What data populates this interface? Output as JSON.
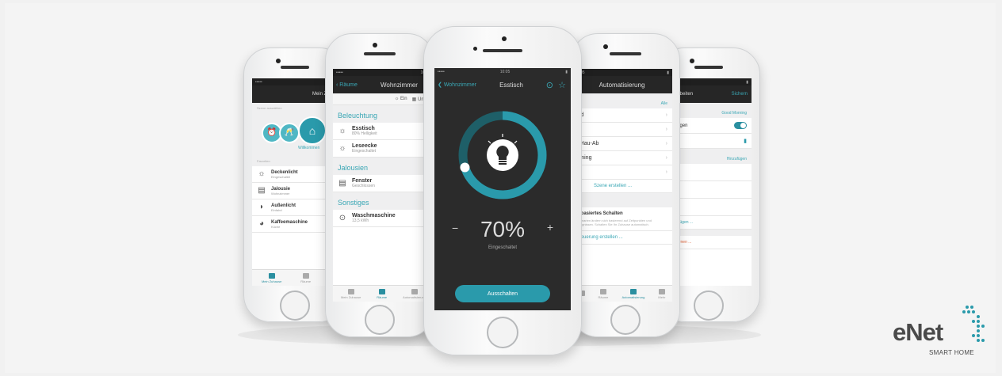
{
  "phone1": {
    "nav_title": "Mein Zuhause",
    "section_scenes": "Szene auswählen",
    "scene_label": "Willkommen",
    "section_favorites": "Favoriten",
    "favorites": [
      {
        "label": "Deckenlicht",
        "sub": "Eingeschaltet"
      },
      {
        "label": "Jalousie",
        "sub": "Wohnzimmer"
      },
      {
        "label": "Außenlicht",
        "sub": "Einfahrt"
      },
      {
        "label": "Kaffeemaschine",
        "sub": "Küche"
      }
    ],
    "tabs": [
      "Mein Zuhause",
      "Räume",
      "Au"
    ]
  },
  "phone2": {
    "back_label": "Räume",
    "nav_title": "Wohnzimmer",
    "filter_on": "Ein",
    "filter_under": "Unten",
    "section_lighting": "Beleuchtung",
    "lighting": [
      {
        "label": "Esstisch",
        "sub": "80% Helligkeit"
      },
      {
        "label": "Leseecke",
        "sub": "Eingeschaltet"
      }
    ],
    "section_blinds": "Jalousien",
    "blinds": [
      {
        "label": "Fenster",
        "sub": "Geschlossen"
      }
    ],
    "section_misc": "Sonstiges",
    "misc": [
      {
        "label": "Waschmaschine",
        "sub": "13,5 kWh"
      }
    ],
    "tabs": [
      "Mein Zuhause",
      "Räume",
      "Automatisierung"
    ]
  },
  "phone3": {
    "back_label": "Wohnzimmer",
    "nav_title": "Esstisch",
    "status_time": "10:05",
    "percent": "70%",
    "percent_value": 70,
    "state_label": "Eingeschaltet",
    "minus": "−",
    "plus": "+",
    "button_label": "Ausschalten",
    "accent": "#2a9aab"
  },
  "phone4": {
    "nav_title": "Automatisierung",
    "top_link": "Alle",
    "items": [
      "ind",
      "",
      "r-Hau-Ab",
      "orning",
      "n"
    ],
    "create_scene": "Szene erstellen ...",
    "info_title": "utbasiertes Schalten",
    "info_text": "Szenarien ändern sich basierend auf Zeitpunkten und Ereignissen. Schalten Sie Ihr Zuhause automatisch.",
    "create_control": "Steuerung erstellen ...",
    "tabs": [
      "",
      "Räume",
      "Automatisierung",
      "Mehr"
    ]
  },
  "phone5": {
    "nav_title": "ene bearbeiten",
    "nav_right": "Sichern",
    "scene_name": "Good Morning",
    "show_label": "e\" anzeigen",
    "section_devices": "Hinzufügen",
    "devices": [
      {
        "label": "chlafzim",
        "sub": "Jalousie"
      },
      {
        "label": "5%",
        "sub": "Licht"
      },
      {
        "label": "chlafzim",
        "sub": "Jalousie"
      }
    ],
    "add_link": "ion hinzufügen ...",
    "remove_link": "ene entfernen ..."
  },
  "logo": {
    "brand": "eNet",
    "tagline": "SMART HOME",
    "color": "#2a9aab"
  }
}
